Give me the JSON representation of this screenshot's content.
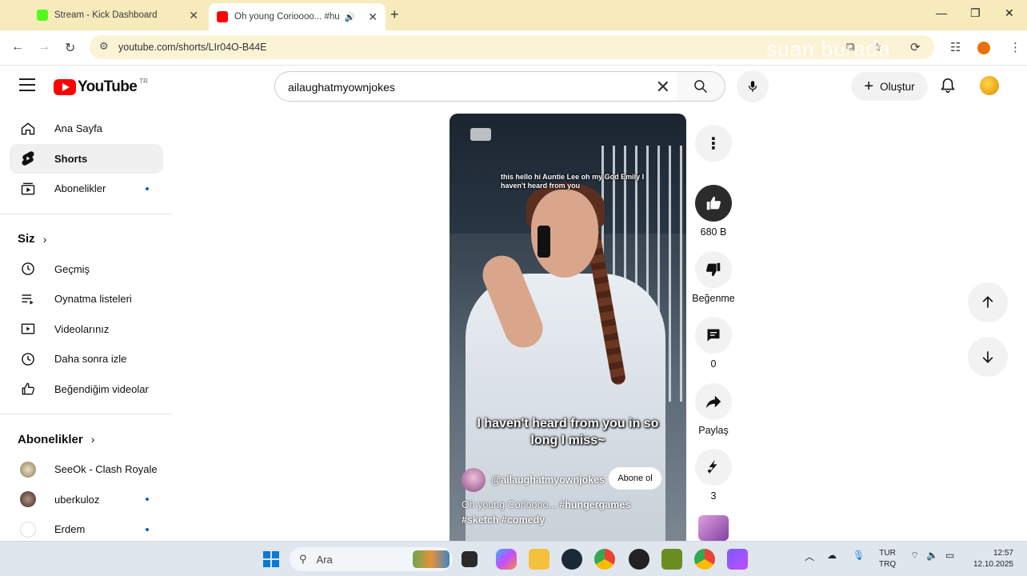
{
  "browser": {
    "tabs": [
      {
        "title": "Stream - Kick Dashboard",
        "favicon_color": "#53fc18"
      },
      {
        "title": "Oh young Corioooo... #hu",
        "favicon_color": "#ff0000"
      }
    ],
    "url": "youtube.com/shorts/LIr04O-B44E"
  },
  "overlay_text": "suan burada",
  "youtube": {
    "logo_text": "YouTube",
    "country": "TR",
    "search_value": "ailaughatmyownjokes",
    "create_label": "Oluştur"
  },
  "sidebar": {
    "main": [
      {
        "label": "Ana Sayfa",
        "icon": "home-icon"
      },
      {
        "label": "Shorts",
        "icon": "shorts-icon"
      },
      {
        "label": "Abonelikler",
        "icon": "subscriptions-icon"
      }
    ],
    "you_section": "Siz",
    "you_items": [
      {
        "label": "Geçmiş",
        "icon": "history-icon"
      },
      {
        "label": "Oynatma listeleri",
        "icon": "playlist-icon"
      },
      {
        "label": "Videolarınız",
        "icon": "your-videos-icon"
      },
      {
        "label": "Daha sonra izle",
        "icon": "watch-later-icon"
      },
      {
        "label": "Beğendiğim videolar",
        "icon": "liked-icon"
      }
    ],
    "subs_section": "Abonelikler",
    "subs": [
      {
        "label": "SeeOk - Clash Royale"
      },
      {
        "label": "uberkuloz"
      },
      {
        "label": "Erdem"
      }
    ]
  },
  "video": {
    "caption_top": "this hello hi Auntie Lee oh my God Emily I haven't heard from you",
    "caption_main": "I haven't heard from you in so long I miss~",
    "channel": "@ailaughatmyownjokes",
    "subscribe_label": "Abone ol",
    "title_plain": "Oh young Corioooo...",
    "title_tags1": "#hungergames",
    "title_tags2": "#sketch #comedy"
  },
  "actions": {
    "like_count": "680 B",
    "dislike_label": "Beğenme",
    "comment_count": "0",
    "share_label": "Paylaş",
    "remix_count": "3"
  },
  "taskbar": {
    "search_placeholder": "Ara",
    "lang_top": "TUR",
    "lang_bottom": "TRQ",
    "time": "12:57",
    "date": "12.10.2025"
  }
}
